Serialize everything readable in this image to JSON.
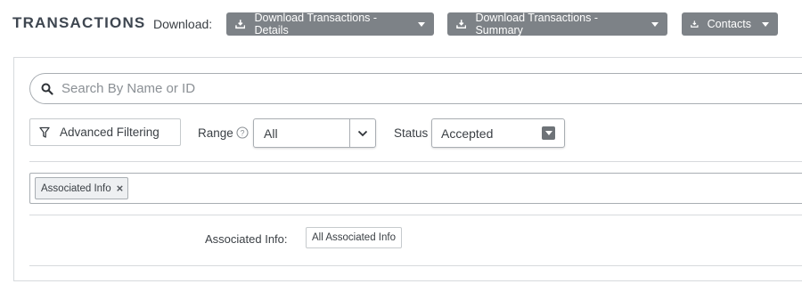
{
  "header": {
    "title": "TRANSACTIONS",
    "download_label": "Download:",
    "buttons": [
      {
        "label": "Download Transactions - Details",
        "icon": "download-tray-icon"
      },
      {
        "label": "Download Transactions - Summary",
        "icon": "download-tray-icon"
      },
      {
        "label": "Contacts",
        "icon": "download-tray-icon"
      }
    ]
  },
  "filters": {
    "search": {
      "placeholder": "Search By Name or ID",
      "value": "",
      "icon": "search-icon"
    },
    "advanced_button": {
      "label": "Advanced Filtering",
      "icon": "funnel-icon"
    },
    "range": {
      "label": "Range",
      "value": "All",
      "help_icon": "question-circle-icon"
    },
    "status": {
      "label": "Status",
      "value": "Accepted"
    },
    "tags": [
      {
        "label": "Associated Info"
      }
    ],
    "associated": {
      "label": "Associated Info:",
      "button": "All Associated Info"
    }
  },
  "colors": {
    "button_bg": "#7d8287",
    "border": "#a9aeb3",
    "text": "#3a3f44",
    "title": "#3e4650"
  }
}
